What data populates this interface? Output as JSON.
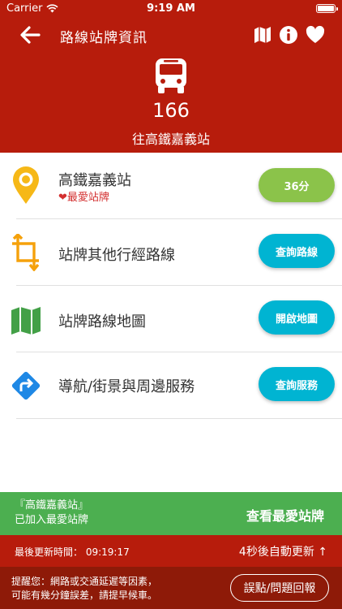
{
  "status_bar": {
    "carrier": "Carrier",
    "time": "9:19 AM"
  },
  "header": {
    "title": "路線站牌資訊",
    "route_number": "166",
    "destination": "往高鐵嘉義站"
  },
  "rows": [
    {
      "label": "高鐵嘉義站",
      "sub": "❤最愛站牌",
      "button": "36分",
      "icon": "location-pin-icon"
    },
    {
      "label": "站牌其他行經路線",
      "button": "查詢路線",
      "icon": "crop-routes-icon"
    },
    {
      "label": "站牌路線地圖",
      "button": "開啟地圖",
      "icon": "map-icon"
    },
    {
      "label": "導航/街景與周邊服務",
      "button": "查詢服務",
      "icon": "directions-icon"
    }
  ],
  "toast": {
    "message_line1": "『高鐵嘉義站』",
    "message_line2": "已加入最愛站牌",
    "action": "查看最愛站牌"
  },
  "update_bar": {
    "last_updated": "最後更新時間：  09:19:17",
    "auto_refresh": "4秒後自動更新 ↑"
  },
  "footer": {
    "note_line1": "提醒您：網路或交通延遲等因素，",
    "note_line2": "可能有幾分鐘誤差，請提早候車。",
    "report_button": "誤點/問題回報"
  },
  "colors": {
    "header_red": "#b71c0c",
    "footer_dark_red": "#8e1a08",
    "toast_green": "#4caf50",
    "pill_green": "#8bc34a",
    "pill_cyan": "#00b4d2",
    "favorite_red": "#d32f2f"
  }
}
